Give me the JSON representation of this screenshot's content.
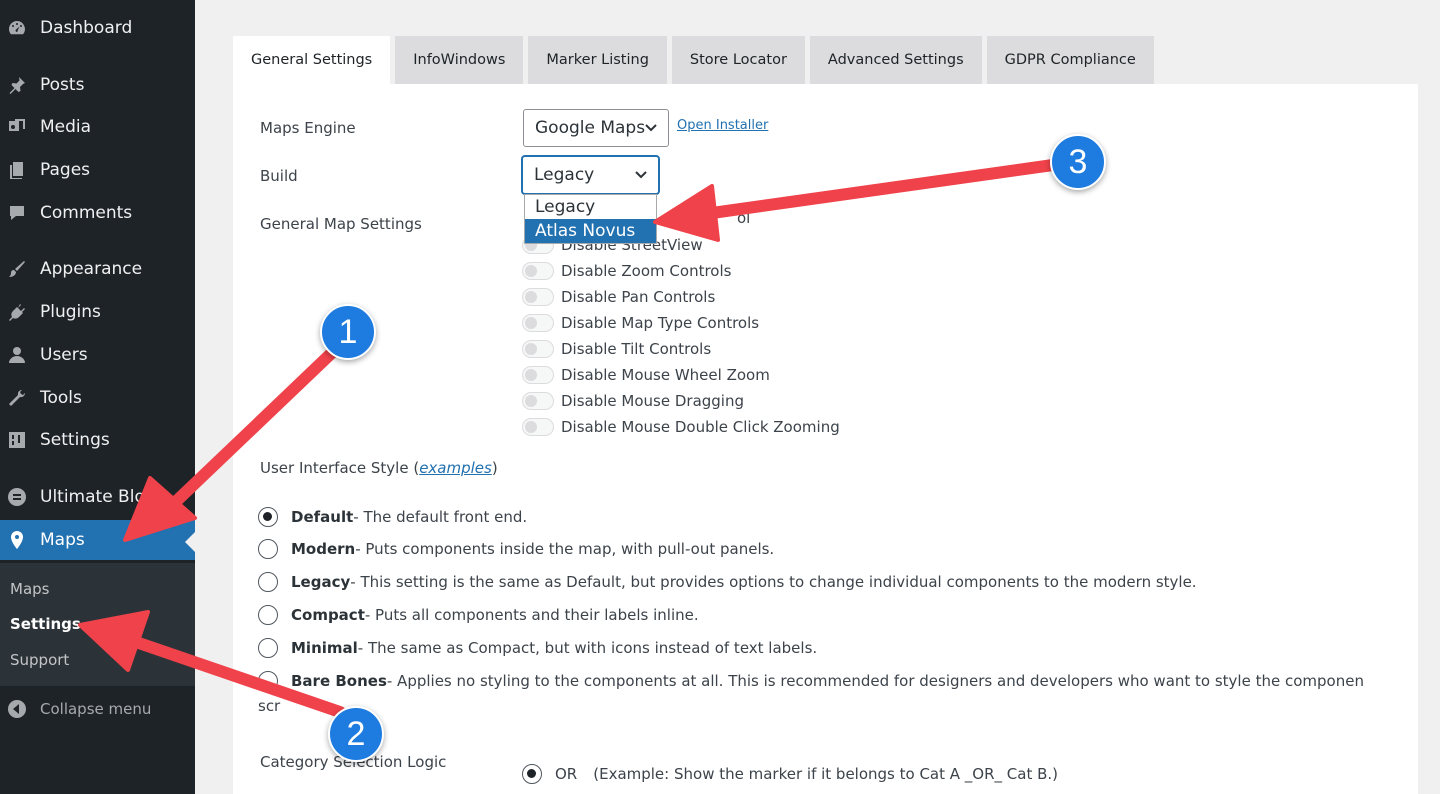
{
  "sidebar": {
    "items": [
      {
        "label": "Dashboard",
        "icon": "dashboard-icon"
      },
      {
        "label": "Posts",
        "icon": "pin-icon"
      },
      {
        "label": "Media",
        "icon": "media-icon"
      },
      {
        "label": "Pages",
        "icon": "pages-icon"
      },
      {
        "label": "Comments",
        "icon": "comment-icon"
      },
      {
        "label": "Appearance",
        "icon": "brush-icon"
      },
      {
        "label": "Plugins",
        "icon": "plug-icon"
      },
      {
        "label": "Users",
        "icon": "user-icon"
      },
      {
        "label": "Tools",
        "icon": "wrench-icon"
      },
      {
        "label": "Settings",
        "icon": "settings-icon"
      },
      {
        "label": "Ultimate Bloc",
        "icon": "block-icon"
      },
      {
        "label": "Maps",
        "icon": "map-pin-icon"
      }
    ],
    "submenu": [
      "Maps",
      "Settings",
      "Support"
    ],
    "collapse_label": "Collapse menu"
  },
  "tabs": [
    "General Settings",
    "InfoWindows",
    "Marker Listing",
    "Store Locator",
    "Advanced Settings",
    "GDPR Compliance"
  ],
  "form": {
    "maps_engine_label": "Maps Engine",
    "maps_engine_value": "Google Maps",
    "open_installer": "Open Installer",
    "build_label": "Build",
    "build_value": "Legacy",
    "build_options": [
      "Legacy",
      "Atlas Novus"
    ],
    "general_map_settings_label": "General Map Settings",
    "toggles": [
      "Disable StreetView",
      "Disable Zoom Controls",
      "Disable Pan Controls",
      "Disable Map Type Controls",
      "Disable Tilt Controls",
      "Disable Mouse Wheel Zoom",
      "Disable Mouse Dragging",
      "Disable Mouse Double Click Zooming"
    ],
    "hidden_toggle_fragment": "ol",
    "ui_style_label": "User Interface Style (",
    "ui_style_link": "examples",
    "ui_style_close": ")",
    "ui_styles": [
      {
        "name": "Default",
        "desc": " - The default front end.",
        "checked": true
      },
      {
        "name": "Modern",
        "desc": " - Puts components inside the map, with pull-out panels.",
        "checked": false
      },
      {
        "name": "Legacy",
        "desc": " - This setting is the same as Default, but provides options to change individual components to the modern style.",
        "checked": false
      },
      {
        "name": "Compact",
        "desc": " - Puts all components and their labels inline.",
        "checked": false
      },
      {
        "name": "Minimal",
        "desc": " - The same as Compact, but with icons instead of text labels.",
        "checked": false
      },
      {
        "name": "Bare Bones",
        "desc": " - Applies no styling to the components at all. This is recommended for designers and developers who want to style the components from",
        "checked": false
      }
    ],
    "bare_bones_wrap": "scr",
    "category_logic_label": "Category Selection Logic",
    "category_or_label": "OR",
    "category_or_desc": "(Example: Show the marker if it belongs to Cat A _OR_ Cat B.)"
  },
  "annotations": {
    "badges": [
      "1",
      "2",
      "3"
    ],
    "arrow_color": "#f0424a"
  }
}
